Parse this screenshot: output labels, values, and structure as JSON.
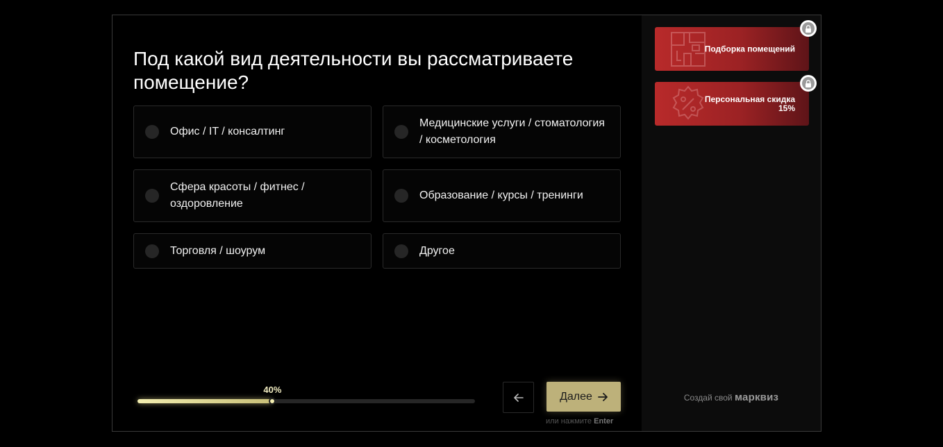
{
  "question": {
    "title": "Под какой вид деятельности вы рассматриваете помещение?"
  },
  "options": [
    {
      "label": "Офис / IT / консалтинг"
    },
    {
      "label": "Медицинские услуги / стоматология / косметология"
    },
    {
      "label": "Сфера красоты / фитнес / оздоровление"
    },
    {
      "label": "Образование / курсы / тренинги"
    },
    {
      "label": "Торговля / шоурум"
    },
    {
      "label": "Другое"
    }
  ],
  "progress": {
    "value": 0.4,
    "label": "40%"
  },
  "nav": {
    "back_icon": "arrow-left-icon",
    "next_label": "Далее",
    "next_icon": "arrow-right-icon",
    "hint_prefix": "или нажмите",
    "hint_key": "Enter"
  },
  "sidebar": {
    "bonuses": [
      {
        "label": "Подборка помещений",
        "icon": "floor-plan-icon",
        "locked": true
      },
      {
        "label": "Персональная скидка 15%",
        "icon": "discount-badge-icon",
        "locked": true
      }
    ],
    "brand_prefix": "Создай свой",
    "brand_name": "марквиз"
  },
  "colors": {
    "accent": "#bdb17a",
    "bonus_red": "#b82a2a",
    "background": "#000000",
    "sidebar_bg": "#0c0c0c"
  }
}
